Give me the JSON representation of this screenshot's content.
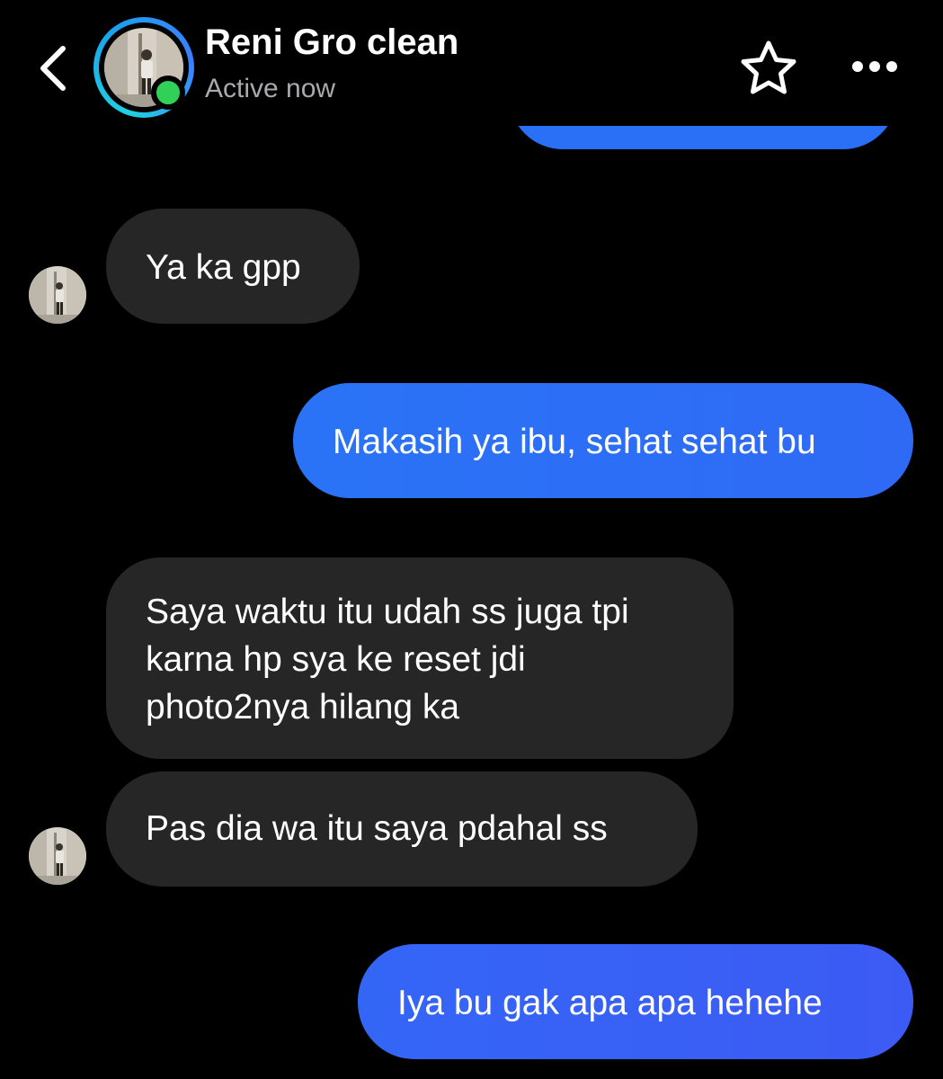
{
  "header": {
    "contact_name": "Reni Gro clean",
    "status": "Active now"
  },
  "icons": {
    "back": "chevron-left-icon",
    "favorite": "star-outline-icon",
    "more": "more-horizontal-icon"
  },
  "colors": {
    "background": "#000000",
    "incoming_bubble": "#262626",
    "outgoing_bubble_start": "#2a73f6",
    "outgoing_bubble_end": "#3b5cf5",
    "presence": "#31d157",
    "status_text": "#a9a9ae"
  },
  "messages": [
    {
      "direction": "incoming",
      "text": "Ya ka gpp"
    },
    {
      "direction": "outgoing",
      "text": "Makasih ya ibu, sehat sehat bu"
    },
    {
      "direction": "incoming",
      "lines": [
        "Saya waktu itu udah ss juga tpi",
        "karna hp sya ke reset jdi",
        "photo2nya hilang ka"
      ]
    },
    {
      "direction": "incoming",
      "text": "Pas dia wa itu saya pdahal ss"
    },
    {
      "direction": "outgoing",
      "text": "Iya bu gak apa apa hehehe"
    }
  ]
}
